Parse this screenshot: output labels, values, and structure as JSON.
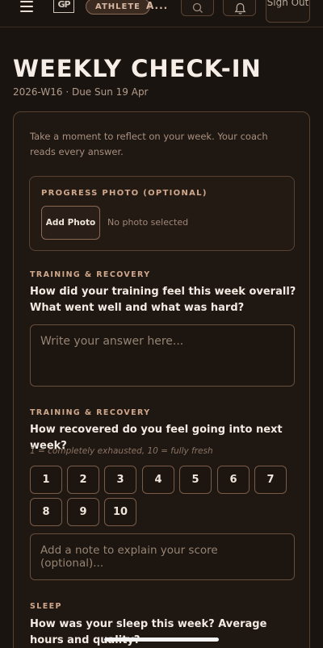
{
  "header": {
    "role": "ATHLETE",
    "user_initial": "A...",
    "signout_label": "Sign Out",
    "logo_text": "GP"
  },
  "page": {
    "title": "WEEKLY CHECK-IN",
    "subtitle": "2026-W16 · Due Sun 19 Apr"
  },
  "form": {
    "intro": "Take a moment to reflect on your week. Your coach reads every answer.",
    "photo": {
      "label": "PROGRESS PHOTO (OPTIONAL)",
      "button": "Add Photo",
      "status": "No photo selected"
    },
    "q1": {
      "section": "TRAINING & RECOVERY",
      "question": "How did your training feel this week overall? What went well and what was hard?",
      "placeholder": "Write your answer here..."
    },
    "q2": {
      "section": "TRAINING & RECOVERY",
      "question": "How recovered do you feel going into next week?",
      "hint": "1 = completely exhausted, 10 = fully fresh",
      "scores": [
        "1",
        "2",
        "3",
        "4",
        "5",
        "6",
        "7",
        "8",
        "9",
        "10"
      ],
      "note_placeholder": "Add a note to explain your score (optional)..."
    },
    "q3": {
      "section": "SLEEP",
      "question": "How was your sleep this week? Average hours and quality?"
    }
  },
  "icons": [
    "menu-icon",
    "search-icon",
    "bell-icon"
  ]
}
